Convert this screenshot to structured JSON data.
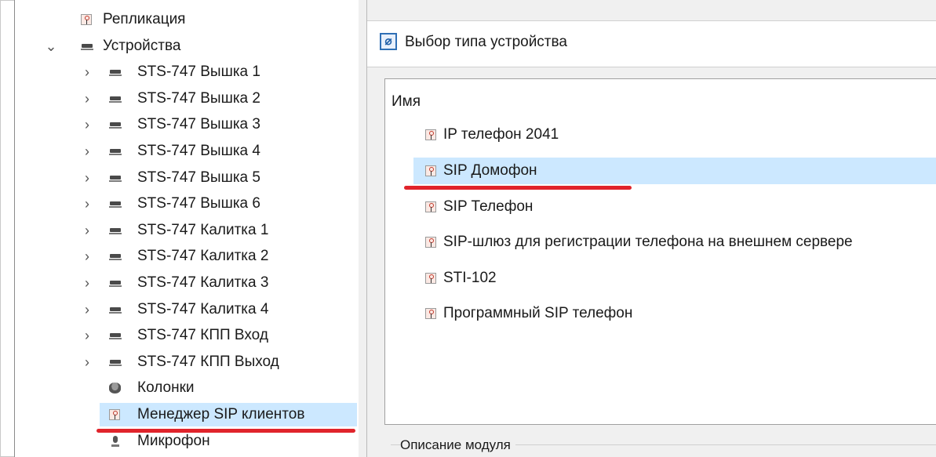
{
  "tree": {
    "items": [
      {
        "label": "Репликация",
        "icon": "sip-manager-icon",
        "expander": ""
      },
      {
        "label": "Устройства",
        "icon": "device-group-icon",
        "expander": "⌄"
      },
      {
        "label": "STS-747 Вышка 1",
        "icon": "device-icon",
        "expander": "›"
      },
      {
        "label": "STS-747 Вышка 2",
        "icon": "device-icon",
        "expander": "›"
      },
      {
        "label": "STS-747 Вышка 3",
        "icon": "device-icon",
        "expander": "›"
      },
      {
        "label": "STS-747 Вышка 4",
        "icon": "device-icon",
        "expander": "›"
      },
      {
        "label": "STS-747 Вышка 5",
        "icon": "device-icon",
        "expander": "›"
      },
      {
        "label": "STS-747 Вышка 6",
        "icon": "device-icon",
        "expander": "›"
      },
      {
        "label": "STS-747 Калитка 1",
        "icon": "device-icon",
        "expander": "›"
      },
      {
        "label": "STS-747 Калитка 2",
        "icon": "device-icon",
        "expander": "›"
      },
      {
        "label": "STS-747 Калитка 3",
        "icon": "device-icon",
        "expander": "›"
      },
      {
        "label": "STS-747 Калитка 4",
        "icon": "device-icon",
        "expander": "›"
      },
      {
        "label": "STS-747 КПП Вход",
        "icon": "device-icon",
        "expander": "›"
      },
      {
        "label": "STS-747 КПП Выход",
        "icon": "device-icon",
        "expander": "›"
      },
      {
        "label": "Колонки",
        "icon": "speaker-icon",
        "expander": ""
      },
      {
        "label": "Менеджер SIP клиентов",
        "icon": "sip-manager-icon",
        "expander": "",
        "selected": true
      },
      {
        "label": "Микрофон",
        "icon": "microphone-icon",
        "expander": ""
      }
    ]
  },
  "dialog": {
    "title": "Выбор типа устройства",
    "title_icon": "device-type-icon",
    "list_header": "Имя",
    "items": [
      {
        "label": "IP телефон 2041"
      },
      {
        "label": "SIP Домофон",
        "selected": true
      },
      {
        "label": "SIP Телефон"
      },
      {
        "label": "SIP-шлюз для регистрации телефона на внешнем сервере"
      },
      {
        "label": "STI-102"
      },
      {
        "label": "Программный SIP телефон"
      }
    ],
    "description_label": "Описание модуля"
  },
  "colors": {
    "selection": "#cce8ff",
    "annotation_underline": "#e0242b"
  }
}
